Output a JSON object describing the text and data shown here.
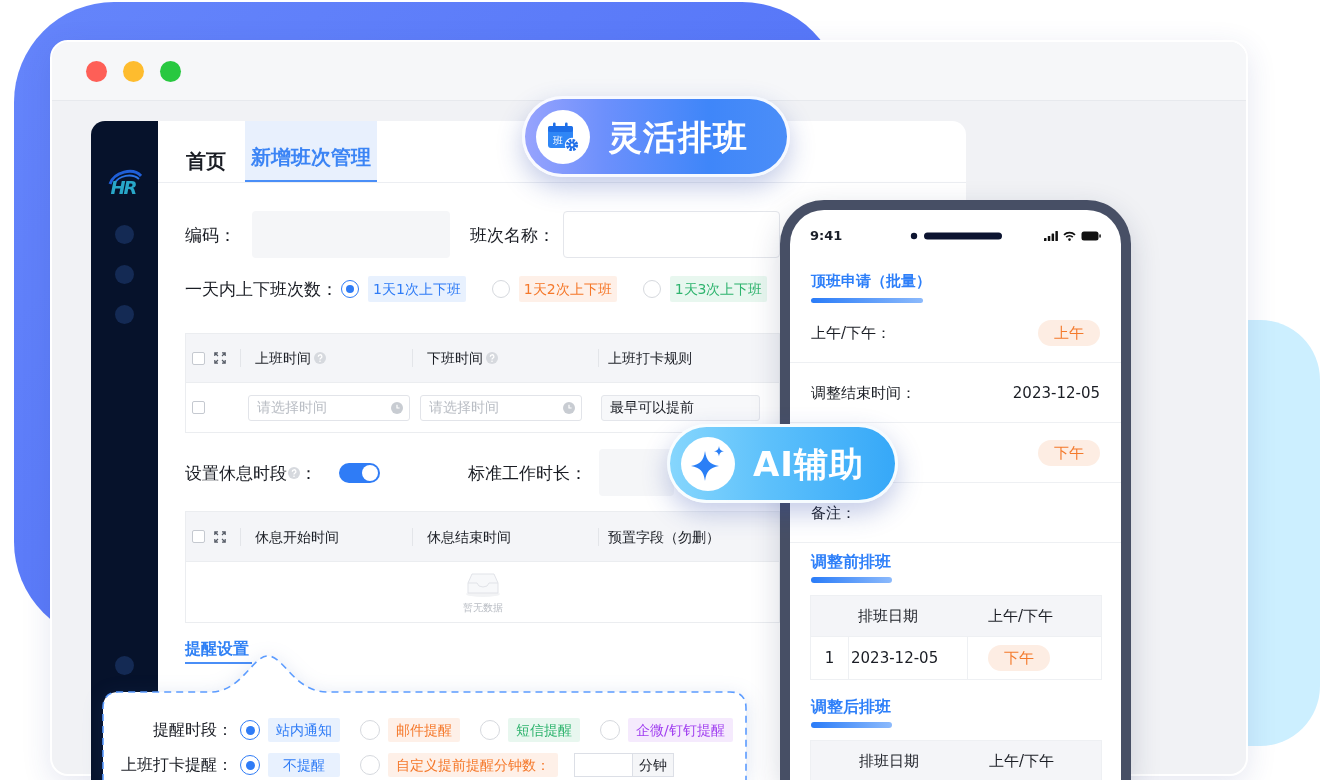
{
  "app": {
    "logo": "HR",
    "tabs": [
      {
        "label": "首页",
        "selected": false
      },
      {
        "label": "新增班次管理",
        "selected": true
      }
    ],
    "fields": [
      {
        "label": "编码：",
        "kind": "filled"
      },
      {
        "label": "班次名称：",
        "kind": "outlined"
      }
    ],
    "shift_count": {
      "label": "一天内上下班次数：",
      "options": [
        {
          "label": "1天1次上下班",
          "selected": true,
          "color": "#2f7cf6"
        },
        {
          "label": "1天2次上下班",
          "selected": false,
          "color": "#f5782a"
        },
        {
          "label": "1天3次上下班",
          "selected": false,
          "color": "#2fb46e"
        }
      ]
    },
    "work_table": {
      "header_checked": false,
      "columns": [
        {
          "label": "上班时间",
          "help": true
        },
        {
          "label": "下班时间",
          "help": true
        },
        {
          "label": "上班打卡规则",
          "help": false
        }
      ],
      "rows": [
        {
          "checked": false,
          "cells": [
            {
              "kind": "time",
              "placeholder": "请选择时间"
            },
            {
              "kind": "time",
              "placeholder": "请选择时间"
            },
            {
              "kind": "value",
              "value": "最早可以提前"
            }
          ]
        }
      ]
    },
    "rest": {
      "label": "设置休息时段",
      "help": true,
      "colon": "：",
      "on": true,
      "duration_label": "标准工作时长："
    },
    "rest_table": {
      "header_checked": false,
      "columns": [
        {
          "label": "休息开始时间",
          "help": false
        },
        {
          "label": "休息结束时间",
          "help": false
        },
        {
          "label": "预置字段（勿删）",
          "help": false
        }
      ],
      "empty_text": "暂无数据"
    },
    "reminder_tab": "提醒设置"
  },
  "reminder_popup": {
    "rows": [
      {
        "label": "提醒时段：",
        "options": [
          {
            "label": "站内通知",
            "selected": true,
            "color": "#2f7cf6"
          },
          {
            "label": "邮件提醒",
            "selected": false,
            "color": "#f5782a"
          },
          {
            "label": "短信提醒",
            "selected": false,
            "color": "#2fb46e"
          },
          {
            "label": "企微/钉钉提醒",
            "selected": false,
            "color": "#a13ff0"
          }
        ]
      },
      {
        "label": "上班打卡提醒：",
        "options": [
          {
            "label": "不提醒",
            "selected": true,
            "color": "#2f7cf6"
          },
          {
            "label": "自定义提前提醒分钟数：",
            "selected": false,
            "color": "#f5782a"
          }
        ],
        "unit": "分钟"
      }
    ]
  },
  "phone": {
    "time": "9:41",
    "title": "顶班申请（批量）",
    "fields": [
      {
        "label": "上午/下午：",
        "kind": "tag",
        "value": "上午"
      },
      {
        "label": "调整结束时间：",
        "kind": "text",
        "value": "2023-12-05"
      },
      {
        "kind": "tag",
        "value": "下午"
      },
      {
        "label": "备注：",
        "kind": "text"
      }
    ],
    "sections": [
      {
        "title": "调整前排班",
        "columns": [
          "排班日期",
          "上午/下午"
        ],
        "rows": [
          {
            "index": "1",
            "date": "2023-12-05",
            "period": "下午"
          }
        ]
      },
      {
        "title": "调整后排班",
        "columns": [
          "排班日期",
          "上午/下午"
        ]
      }
    ]
  },
  "badges": [
    {
      "kind": "schedule",
      "label": "灵活排班",
      "icon_text": "班"
    },
    {
      "kind": "ai",
      "label": "AI辅助"
    }
  ]
}
